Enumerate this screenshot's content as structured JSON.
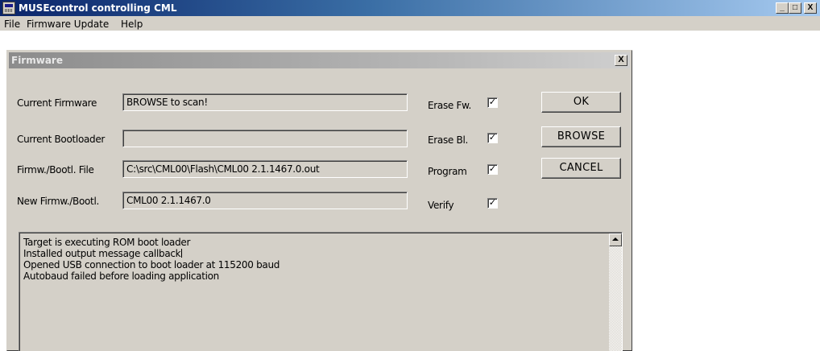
{
  "window": {
    "title": "MUSEcontrol controlling CML",
    "minimize": "_",
    "maximize": "□",
    "close": "X"
  },
  "menu": {
    "items": [
      "File",
      "Firmware Update",
      "Help"
    ]
  },
  "dialog": {
    "title": "Firmware",
    "close": "X",
    "fields": [
      {
        "label": "Current Firmware",
        "value": "BROWSE to scan!"
      },
      {
        "label": "Current Bootloader",
        "value": ""
      },
      {
        "label": "Firmw./Bootl. File",
        "value": "C:\\src\\CML00\\Flash\\CML00 2.1.1467.0.out"
      },
      {
        "label": "New Firmw./Bootl.",
        "value": "CML00 2.1.1467.0"
      }
    ],
    "options": [
      {
        "label": "Erase Fw.",
        "checked": true,
        "mark": "✓"
      },
      {
        "label": "Erase Bl.",
        "checked": true,
        "mark": "✓"
      },
      {
        "label": "Program",
        "checked": true,
        "mark": "✓"
      },
      {
        "label": "Verify",
        "checked": true,
        "mark": "✓"
      }
    ],
    "buttons": {
      "ok": "OK",
      "browse": "BROWSE",
      "cancel": "CANCEL"
    },
    "log": [
      "Target is executing ROM boot loader",
      "Installed output message callback",
      "Opened USB connection to boot loader at 115200 baud",
      "Autobaud failed before loading application"
    ]
  },
  "colors": {
    "title_active": "#0a246a",
    "title_inactive": "#8c8c8c",
    "face": "#d4d0c8"
  }
}
